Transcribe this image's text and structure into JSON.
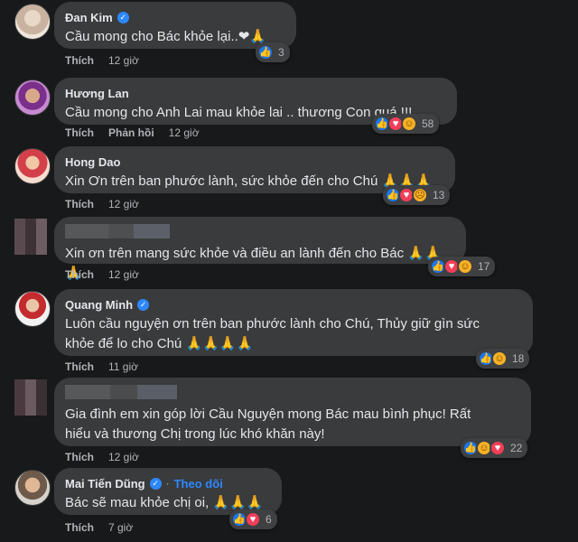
{
  "comments": [
    {
      "name": "Đan Kim",
      "verified": true,
      "follow": "",
      "text": "Cầu mong cho Bác khỏe lại..",
      "emojis": "❤🙏",
      "actions": [
        "Thích"
      ],
      "time": "12 giờ",
      "reactions": [
        "like"
      ],
      "count": "3"
    },
    {
      "name": "Hương Lan",
      "verified": false,
      "follow": "",
      "text": "Cầu mong cho Anh Lai mau khỏe lai .. thương Con quá !!!",
      "emojis": "",
      "actions": [
        "Thích",
        "Phản hồi"
      ],
      "time": "12 giờ",
      "reactions": [
        "like",
        "love",
        "care"
      ],
      "count": "58"
    },
    {
      "name": "Hong Dao",
      "verified": false,
      "follow": "",
      "text": "Xin Ơn trên ban phước lành, sức khỏe đến cho Chú",
      "emojis": "🙏🙏🙏",
      "actions": [
        "Thích"
      ],
      "time": "12 giờ",
      "reactions": [
        "like",
        "love",
        "sad"
      ],
      "count": "13"
    },
    {
      "name": "",
      "verified": false,
      "follow": "",
      "text": "Xin ơn trên mang sức khỏe và điều an lành đến cho Bác",
      "emojis": "🙏🙏🙏",
      "actions": [
        "Thích"
      ],
      "time": "12 giờ",
      "reactions": [
        "like",
        "love",
        "care"
      ],
      "count": "17"
    },
    {
      "name": "Quang Minh",
      "verified": true,
      "follow": "",
      "text": "Luôn cầu nguyện ơn trên ban phước lành cho Chú, Thủy giữ gìn sức\nkhỏe để lo cho Chú",
      "emojis": "🙏🙏🙏🙏",
      "actions": [
        "Thích"
      ],
      "time": "11 giờ",
      "reactions": [
        "like",
        "care"
      ],
      "count": "18"
    },
    {
      "name": "",
      "verified": false,
      "follow": "",
      "text": "Gia đình em xin góp lời Cầu Nguyện mong Bác mau bình phục! Rất\nhiểu và thương Chị trong lúc khó khăn này!",
      "emojis": "",
      "actions": [
        "Thích"
      ],
      "time": "12 giờ",
      "reactions": [
        "like",
        "care",
        "love"
      ],
      "count": "22"
    },
    {
      "name": "Mai Tiến Dũng",
      "verified": true,
      "follow": "Theo dõi",
      "text": "Bác sẽ mau khỏe chị oi, ",
      "emojis": "🙏🙏🙏",
      "actions": [
        "Thích"
      ],
      "time": "7 giờ",
      "reactions": [
        "like",
        "love"
      ],
      "count": "6"
    }
  ],
  "colors": {
    "background": "#18191a",
    "bubble": "#3a3b3c",
    "link": "#2d88ff",
    "like": "#1877f2",
    "love": "#f33e58",
    "care": "#f7b125"
  },
  "icons": {
    "verified": "verified-badge-icon",
    "like": "like-reaction-icon",
    "love": "love-reaction-icon",
    "care": "care-reaction-icon",
    "sad": "sad-reaction-icon",
    "pray": "folded-hands-emoji"
  }
}
